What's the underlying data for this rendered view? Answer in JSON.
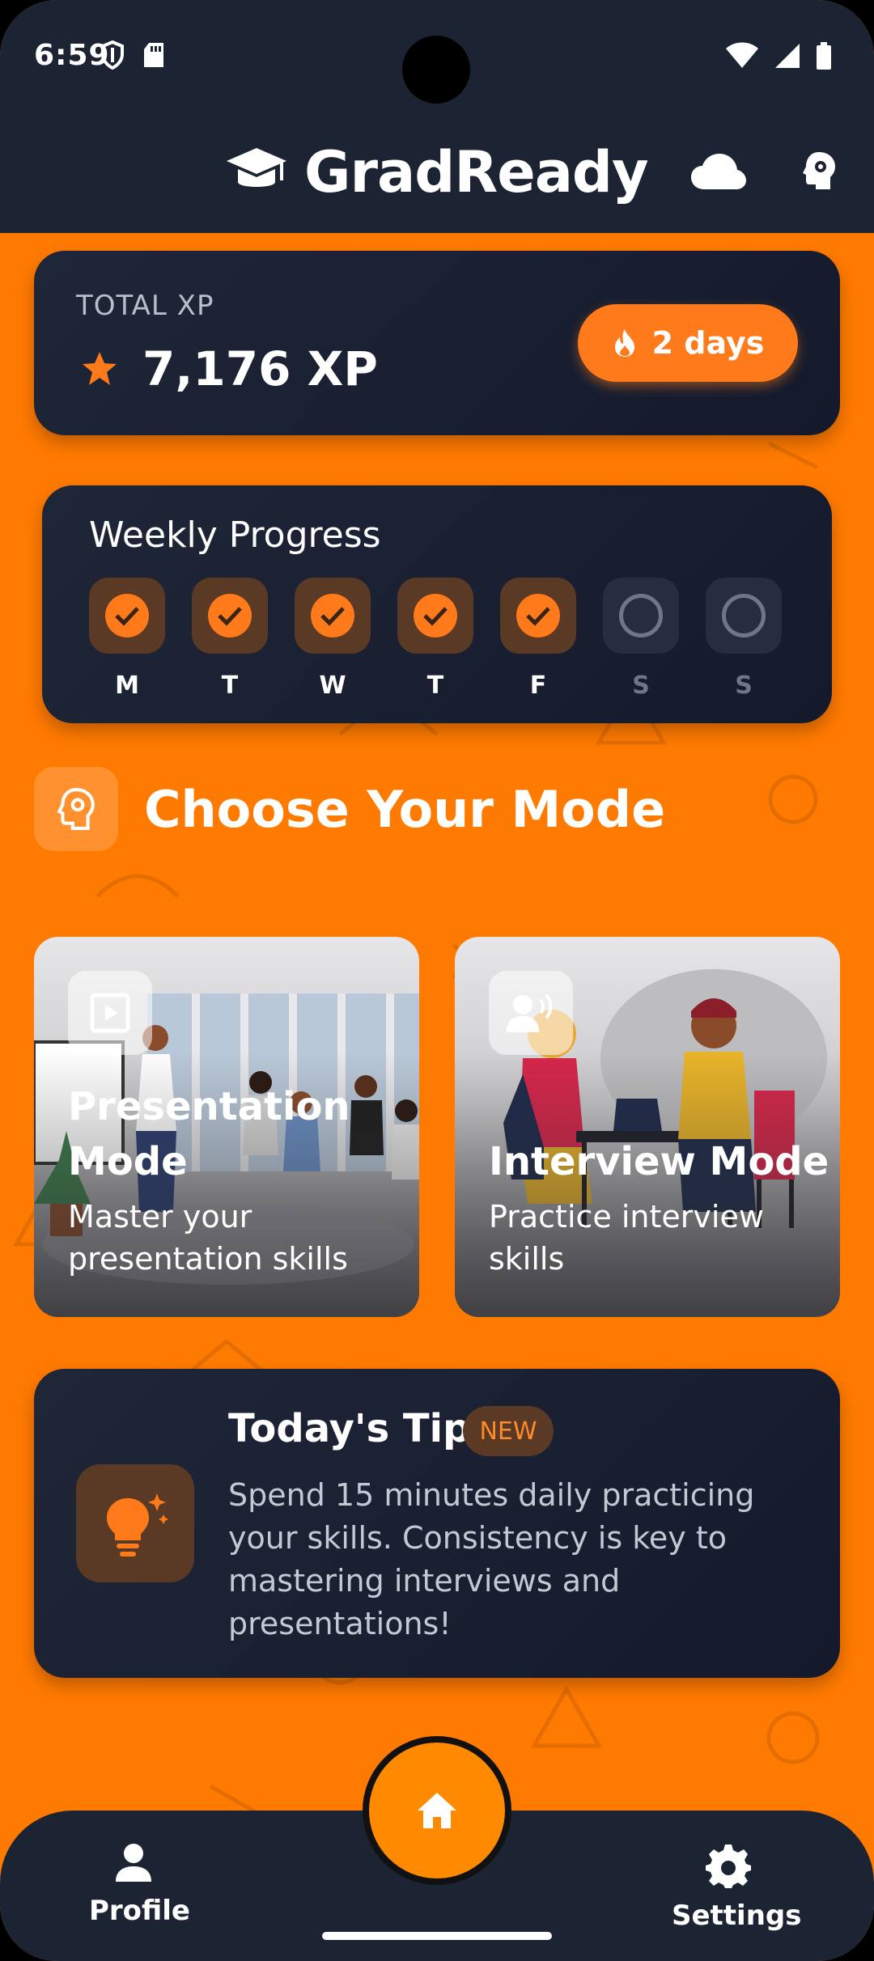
{
  "status": {
    "time": "6:59"
  },
  "app": {
    "title": "GradReady"
  },
  "xp": {
    "label": "TOTAL XP",
    "value": "7,176 XP",
    "streak": "2 days"
  },
  "weekly": {
    "title": "Weekly Progress",
    "days": [
      {
        "label": "M",
        "done": true
      },
      {
        "label": "T",
        "done": true
      },
      {
        "label": "W",
        "done": true
      },
      {
        "label": "T",
        "done": true
      },
      {
        "label": "F",
        "done": true
      },
      {
        "label": "S",
        "done": false
      },
      {
        "label": "S",
        "done": false
      }
    ]
  },
  "modes": {
    "title": "Choose Your Mode",
    "presentation": {
      "name_line1": "Presentation",
      "name_line2": "Mode",
      "desc": "Master your presentation skills"
    },
    "interview": {
      "name": "Interview Mode",
      "desc": "Practice interview skills"
    }
  },
  "tip": {
    "title": "Today's Tip",
    "badge": "NEW",
    "text": "Spend 15 minutes daily practicing your skills. Consistency is key to mastering interviews and presentations!"
  },
  "nav": {
    "profile": "Profile",
    "settings": "Settings"
  },
  "colors": {
    "accent": "#ff7a00",
    "dark": "#1c2433",
    "streak": "#ff7a1a"
  }
}
